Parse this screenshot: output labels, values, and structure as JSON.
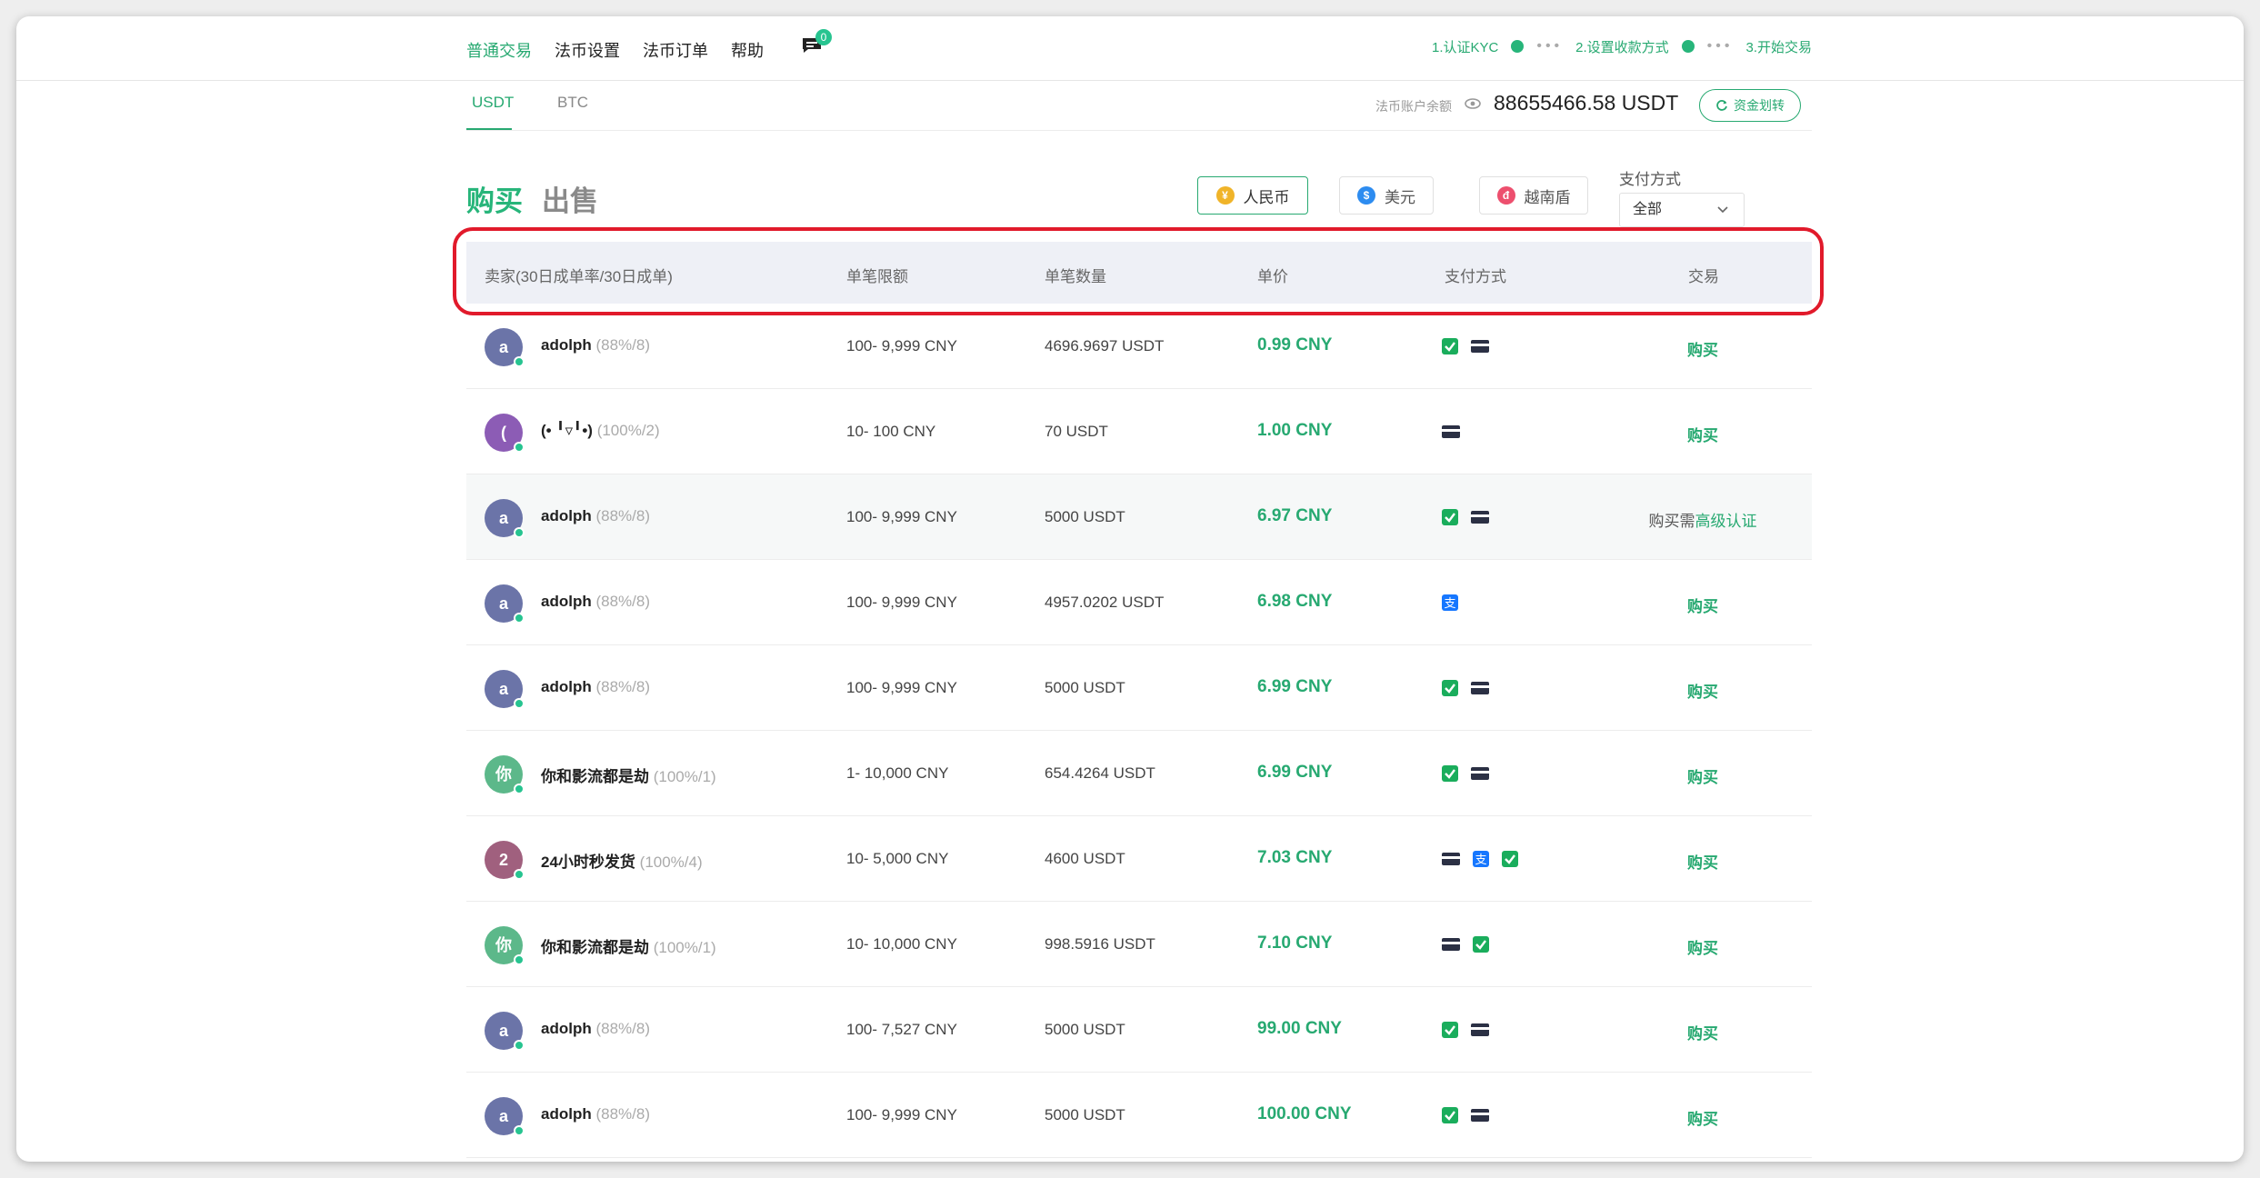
{
  "nav": {
    "items": [
      "普通交易",
      "法币设置",
      "法币订单",
      "帮助"
    ],
    "active_index": 0,
    "message_count": "0"
  },
  "steps": [
    "1.认证KYC",
    "2.设置收款方式",
    "3.开始交易"
  ],
  "currency_tabs": [
    "USDT",
    "BTC"
  ],
  "balance": {
    "label": "法币账户余额",
    "value": "88655466.58 USDT",
    "transfer_label": "资金划转"
  },
  "mode": {
    "buy": "购买",
    "sell": "出售"
  },
  "fiat": [
    {
      "label": "人民币",
      "symbol": "¥",
      "color": "#f0b429",
      "active": true
    },
    {
      "label": "美元",
      "symbol": "$",
      "color": "#2d8cf0",
      "active": false
    },
    {
      "label": "越南盾",
      "symbol": "đ",
      "color": "#ed4f6e",
      "active": false
    }
  ],
  "payment_filter": {
    "label": "支付方式",
    "value": "全部"
  },
  "table": {
    "headers": [
      "卖家(30日成单率/30日成单)",
      "单笔限额",
      "单笔数量",
      "单价",
      "支付方式",
      "交易"
    ],
    "rows": [
      {
        "initial": "a",
        "avatar_color": "#6b74a8",
        "name": "adolph",
        "stats": "(88%/8)",
        "limit": "100- 9,999 CNY",
        "qty": "4696.9697 USDT",
        "price": "0.99 CNY",
        "pays": [
          "wechat",
          "card"
        ],
        "action": "购买"
      },
      {
        "initial": "(",
        "avatar_color": "#8c5cb5",
        "name": "(• ╹▿╹•)",
        "stats": "(100%/2)",
        "limit": "10- 100 CNY",
        "qty": "70 USDT",
        "price": "1.00 CNY",
        "pays": [
          "card"
        ],
        "action": "购买"
      },
      {
        "initial": "a",
        "avatar_color": "#6b74a8",
        "name": "adolph",
        "stats": "(88%/8)",
        "limit": "100- 9,999 CNY",
        "qty": "5000 USDT",
        "price": "6.97 CNY",
        "pays": [
          "wechat",
          "card"
        ],
        "action": "购买需",
        "action_link": "高级认证"
      },
      {
        "initial": "a",
        "avatar_color": "#6b74a8",
        "name": "adolph",
        "stats": "(88%/8)",
        "limit": "100- 9,999 CNY",
        "qty": "4957.0202 USDT",
        "price": "6.98 CNY",
        "pays": [
          "alipay"
        ],
        "action": "购买"
      },
      {
        "initial": "a",
        "avatar_color": "#6b74a8",
        "name": "adolph",
        "stats": "(88%/8)",
        "limit": "100- 9,999 CNY",
        "qty": "5000 USDT",
        "price": "6.99 CNY",
        "pays": [
          "wechat",
          "card"
        ],
        "action": "购买"
      },
      {
        "initial": "你",
        "avatar_color": "#5cb88a",
        "name": "你和影流都是劫",
        "stats": "(100%/1)",
        "limit": "1- 10,000 CNY",
        "qty": "654.4264 USDT",
        "price": "6.99 CNY",
        "pays": [
          "wechat",
          "card"
        ],
        "action": "购买"
      },
      {
        "initial": "2",
        "avatar_color": "#a0607e",
        "name": "24小时秒发货",
        "stats": "(100%/4)",
        "limit": "10- 5,000 CNY",
        "qty": "4600 USDT",
        "price": "7.03 CNY",
        "pays": [
          "card",
          "alipay",
          "wechat"
        ],
        "action": "购买"
      },
      {
        "initial": "你",
        "avatar_color": "#5cb88a",
        "name": "你和影流都是劫",
        "stats": "(100%/1)",
        "limit": "10- 10,000 CNY",
        "qty": "998.5916 USDT",
        "price": "7.10 CNY",
        "pays": [
          "card",
          "wechat"
        ],
        "action": "购买"
      },
      {
        "initial": "a",
        "avatar_color": "#6b74a8",
        "name": "adolph",
        "stats": "(88%/8)",
        "limit": "100- 7,527 CNY",
        "qty": "5000 USDT",
        "price": "99.00 CNY",
        "pays": [
          "wechat",
          "card"
        ],
        "action": "购买"
      },
      {
        "initial": "a",
        "avatar_color": "#6b74a8",
        "name": "adolph",
        "stats": "(88%/8)",
        "limit": "100- 9,999 CNY",
        "qty": "5000 USDT",
        "price": "100.00 CNY",
        "pays": [
          "wechat",
          "card"
        ],
        "action": "购买"
      }
    ]
  }
}
